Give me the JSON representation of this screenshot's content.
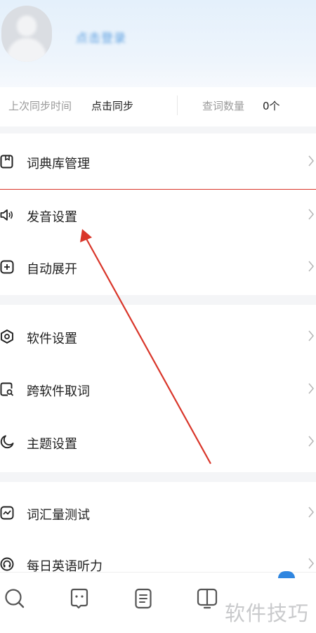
{
  "profile": {
    "username": "点击登录"
  },
  "sync": {
    "last_sync_label": "上次同步时间",
    "sync_action": "点击同步",
    "lookup_count_label": "查词数量",
    "lookup_count_value": "0个"
  },
  "menu": {
    "group1": [
      {
        "label": "词典库管理",
        "icon": "book-icon"
      },
      {
        "label": "发音设置",
        "icon": "speaker-icon"
      },
      {
        "label": "自动展开",
        "icon": "plus-square-icon"
      }
    ],
    "group2": [
      {
        "label": "软件设置",
        "icon": "hexagon-settings-icon"
      },
      {
        "label": "跨软件取词",
        "icon": "search-doc-icon"
      },
      {
        "label": "主题设置",
        "icon": "moon-icon"
      }
    ],
    "group3": [
      {
        "label": "词汇量测试",
        "icon": "chart-square-icon"
      },
      {
        "label": "每日英语听力",
        "icon": "headphone-circle-icon"
      }
    ]
  },
  "tabbar": {
    "tabs": [
      "search-tab-icon",
      "robot-tab-icon",
      "notes-tab-icon",
      "book-tab-icon"
    ]
  },
  "watermark": "软件技巧",
  "colors": {
    "header_bg": "#e4f0fb",
    "annotation_red": "#d9362a",
    "accent_blue": "#2f86e0"
  }
}
